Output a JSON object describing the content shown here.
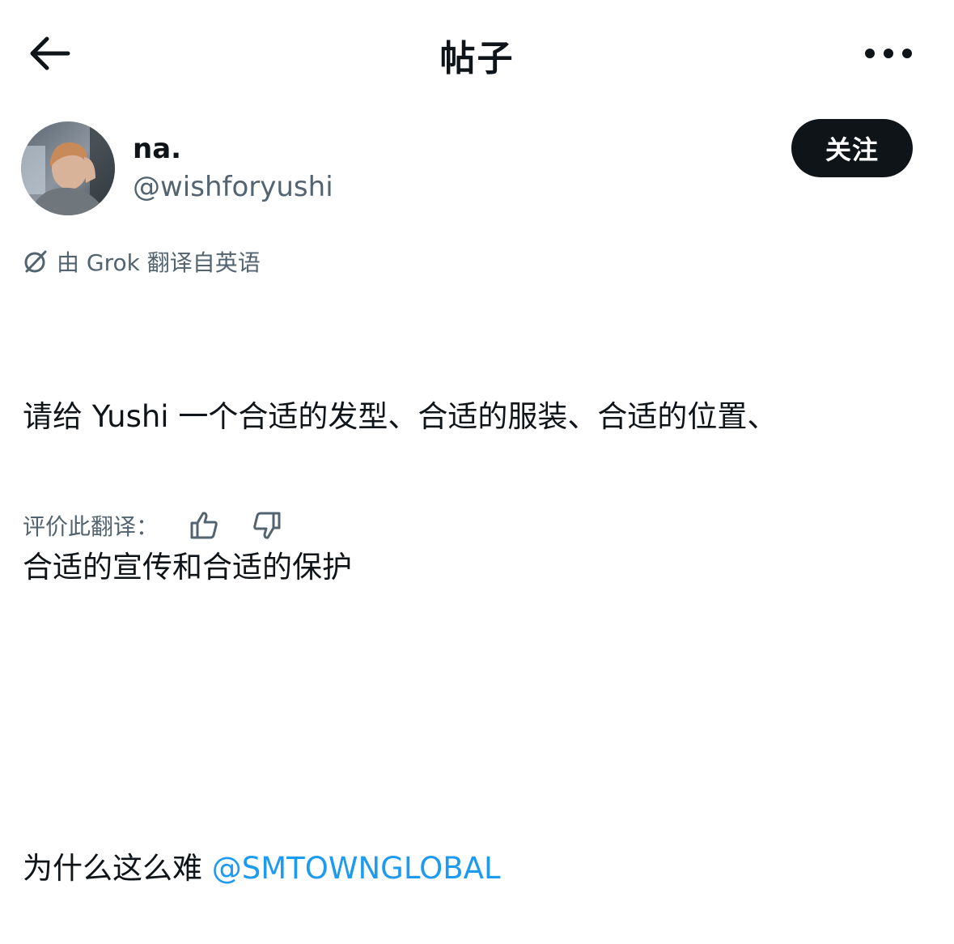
{
  "header": {
    "title": "帖子",
    "back_icon": "arrow-left-icon",
    "more_icon": "more-horizontal-icon"
  },
  "author": {
    "display_name": "na.",
    "handle": "@wishforyushi",
    "follow_label": "关注",
    "avatar_icon": "user-avatar"
  },
  "translation": {
    "note": "由 Grok 翻译自英语",
    "icon": "grok-icon"
  },
  "post": {
    "line1": "请给 Yushi 一个合适的发型、合适的服装、合适的位置、",
    "line2": "合适的宣传和合适的保护",
    "line3_text": "为什么这么难 ",
    "mention": "@SMTOWNGLOBAL"
  },
  "rating": {
    "label": "评价此翻译：",
    "thumb_up_icon": "thumb-up-icon",
    "thumb_down_icon": "thumb-down-icon"
  },
  "colors": {
    "text": "#0f1419",
    "secondary": "#536471",
    "link": "#1d9bf0",
    "button_bg": "#0f1419"
  }
}
